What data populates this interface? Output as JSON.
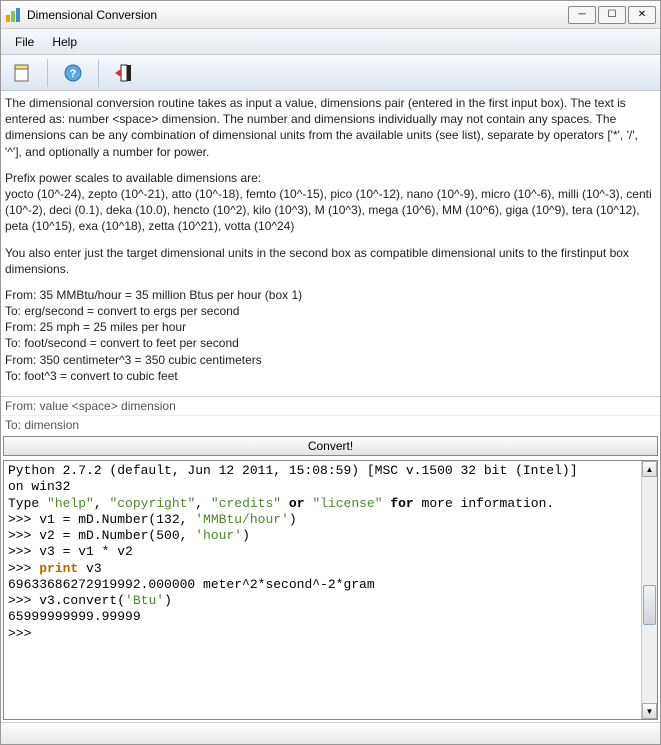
{
  "window": {
    "title": "Dimensional Conversion"
  },
  "menu": {
    "items": [
      "File",
      "Help"
    ]
  },
  "toolbar": {
    "icons": [
      "new-note-icon",
      "help-icon",
      "exit-icon"
    ]
  },
  "help": {
    "p1": "The dimensional conversion routine takes as input a value, dimensions pair (entered in the first input box). The text is entered as: number <space> dimension.  The number and dimensions individually may not contain any spaces.  The dimensions can be any combination of dimensional units from the available units (see list), separate by operators ['*', '/', '^'], and optionally a number for power.",
    "p2a": "Prefix power scales to available dimensions are:",
    "p2b": "yocto (10^-24), zepto (10^-21), atto (10^-18), femto (10^-15), pico (10^-12), nano (10^-9), micro (10^-6), milli (10^-3), centi (10^-2), deci (0.1), deka (10.0), hencto (10^2), kilo (10^3), M (10^3), mega (10^6), MM (10^6), giga (10^9), tera (10^12), peta (10^15), exa (10^18), zetta (10^21), votta (10^24)",
    "p3": "You also enter just the target dimensional units in the second box as compatible dimensional units to the firstinput box dimensions.",
    "ex1": "From: 35 MMBtu/hour       = 35 million Btus per hour (box 1)",
    "ex2": "To: erg/second         = convert to ergs per second",
    "ex3": "From: 25 mph             = 25 miles per hour",
    "ex4": "To: foot/second        = convert to feet per second",
    "ex5": "From: 350 centimeter^3   = 350 cubic centimeters",
    "ex6": "To: foot^3             = convert to cubic feet"
  },
  "inputs": {
    "from_placeholder": "From: value <space> dimension",
    "to_placeholder": "To: dimension",
    "convert_label": "Convert!"
  },
  "console": {
    "l1a": "Python 2.7.2 (default, Jun 12 2011, 15:08:59) [MSC v.1500 32 bit (Intel)]",
    "l1b": "on win32",
    "l2a": "Type ",
    "l2b": "\"help\"",
    "l2c": ", ",
    "l2d": "\"copyright\"",
    "l2e": ", ",
    "l2f": "\"credits\"",
    "l2g": " or ",
    "l2h": "\"license\"",
    "l2i": " for ",
    "l2j": "more information.",
    "prompt": ">>> ",
    "l3a": "v1 = mD.Number(132, ",
    "l3b": "'MMBtu/hour'",
    "l3c": ")",
    "l4a": "v2 = mD.Number(500, ",
    "l4b": "'hour'",
    "l4c": ")",
    "l5": "v3 = v1 * v2",
    "l6a": "print",
    "l6b": " v3",
    "l7": "69633686272919992.000000 meter^2*second^-2*gram",
    "l8a": "v3.convert(",
    "l8b": "'Btu'",
    "l8c": ")",
    "l9": "65999999999.99999"
  }
}
